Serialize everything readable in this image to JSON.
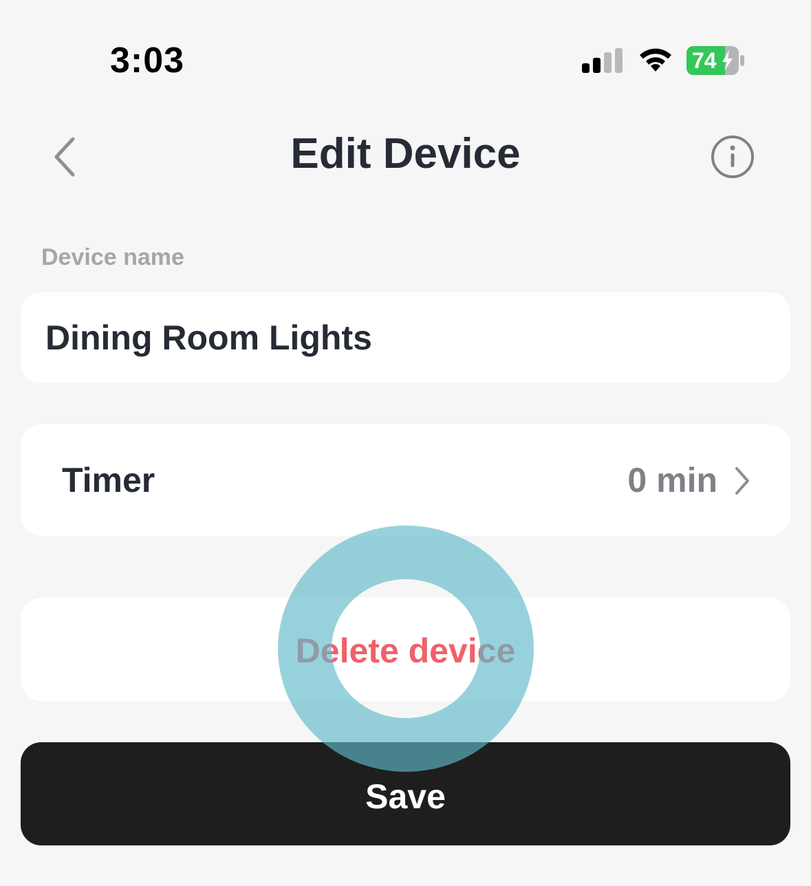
{
  "status_bar": {
    "time": "3:03",
    "battery_level": "74",
    "signal_icon": "cellular-signal-icon",
    "wifi_icon": "wifi-icon",
    "battery_icon": "battery-charging-icon",
    "battery_color": "#34c759"
  },
  "header": {
    "title": "Edit Device",
    "back_icon": "chevron-left-icon",
    "info_icon": "info-circle-icon"
  },
  "device_name": {
    "label": "Device name",
    "value": "Dining Room Lights"
  },
  "timer": {
    "label": "Timer",
    "value": "0 min",
    "chevron_icon": "chevron-right-icon"
  },
  "delete": {
    "label": "Delete device",
    "color": "#f0606a"
  },
  "save": {
    "label": "Save",
    "background": "#1e1e1e"
  },
  "colors": {
    "background": "#f6f6f6",
    "text_primary": "#262b35",
    "text_secondary": "#7e8187",
    "tap_indicator": "#60bacb"
  }
}
